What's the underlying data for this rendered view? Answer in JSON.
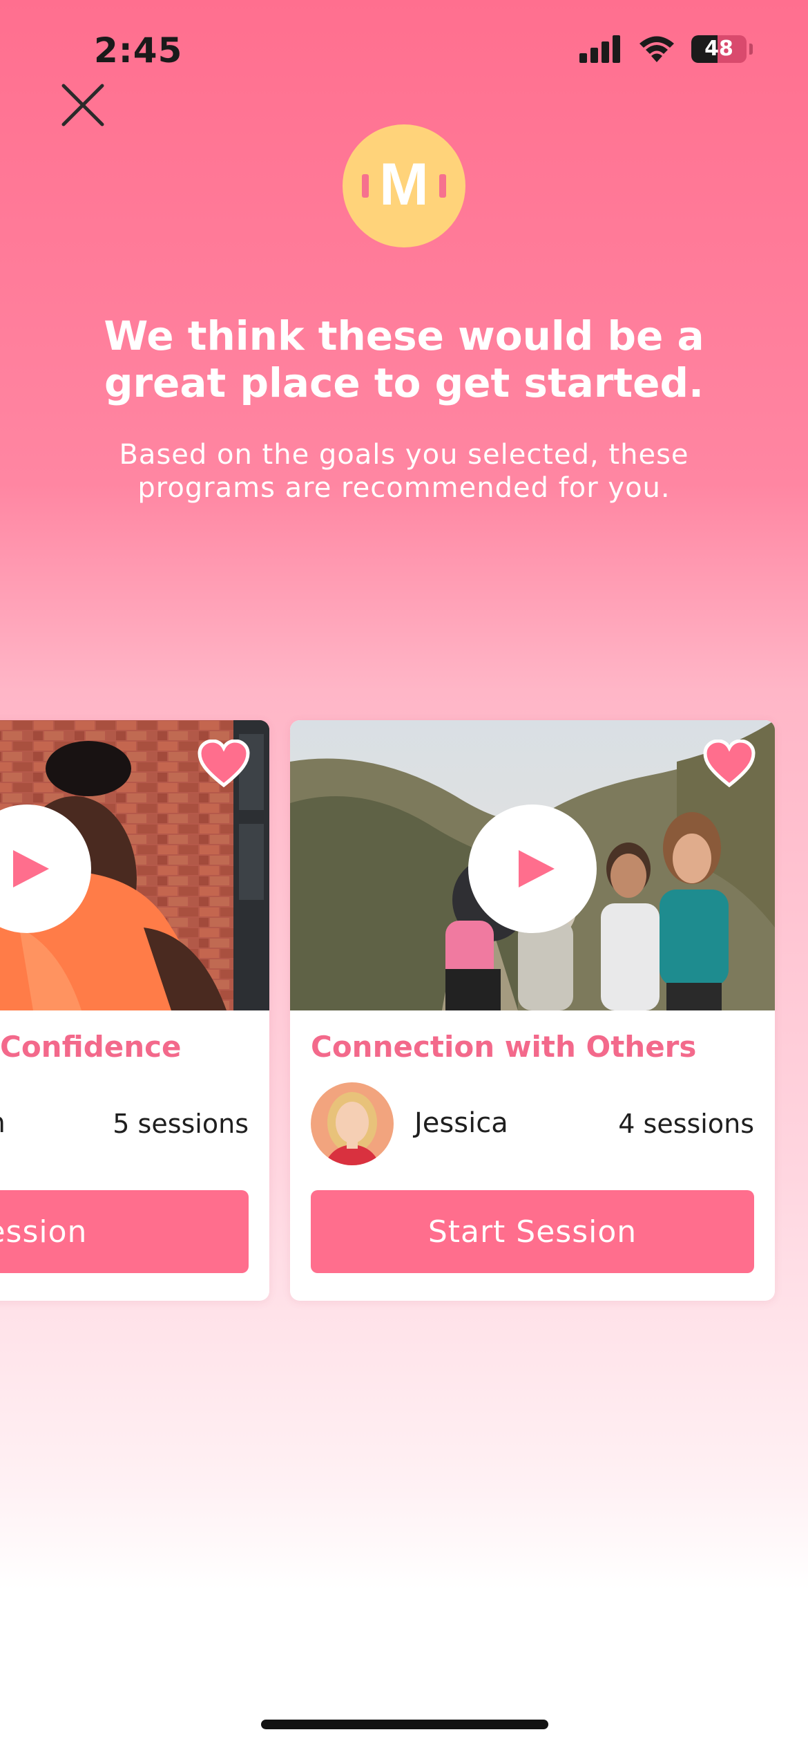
{
  "status_bar": {
    "time": "2:45",
    "battery_level": "48",
    "battery_fraction": 0.48
  },
  "header": {
    "close_icon": "close-icon",
    "logo_letter": "M",
    "headline": "We think these would be a great place to get started.",
    "subtext": "Based on the goals you selected, these programs are recommended for you."
  },
  "programs": [
    {
      "title": "Confidence",
      "instructor": "ah",
      "sessions": "5 sessions",
      "cta": "Session"
    },
    {
      "title": "Connection with Others",
      "instructor": "Jessica",
      "sessions": "4 sessions",
      "cta": "Start Session"
    }
  ],
  "colors": {
    "accent": "#ff6e8d",
    "title_pink": "#f3698b",
    "logo_yellow": "#ffd37a"
  }
}
